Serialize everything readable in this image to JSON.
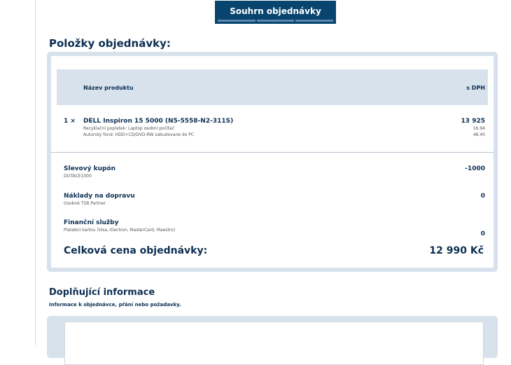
{
  "summary_button": {
    "label": "Souhrn objednávky"
  },
  "items_section": {
    "title": "Položky objednávky:",
    "header": {
      "product": "Název produktu",
      "price": "s DPH"
    },
    "items": [
      {
        "qty": "1 ×",
        "name": "DELL Inspiron 15 5000 (N5-5558-N2-311S)",
        "fees": [
          {
            "label": "Recyklační poplatek: Laptop osobní počítač",
            "value": "16.94"
          },
          {
            "label": "Autorský fond: HDD+CD/DVD-RW zabudované do PC",
            "value": "48.40"
          }
        ],
        "price": "13 925"
      }
    ],
    "coupon": {
      "label": "Slevový kupón",
      "code": "DOTACE1000",
      "value": "-1000"
    },
    "shipping": {
      "label": "Náklady na dopravu",
      "method": "Osobně TSB Partner",
      "value": "0"
    },
    "finance": {
      "label": "Finanční služby",
      "method": "Platební kartou (Visa, Electron, MasterCard, Maestro)",
      "value": "0"
    },
    "total": {
      "label": "Celková cena objednávky:",
      "value": "12 990 Kč"
    }
  },
  "info_section": {
    "title": "Doplňující informace",
    "subtitle": "Informace k objednávce, přání nebo požadavky.",
    "textarea_value": ""
  }
}
